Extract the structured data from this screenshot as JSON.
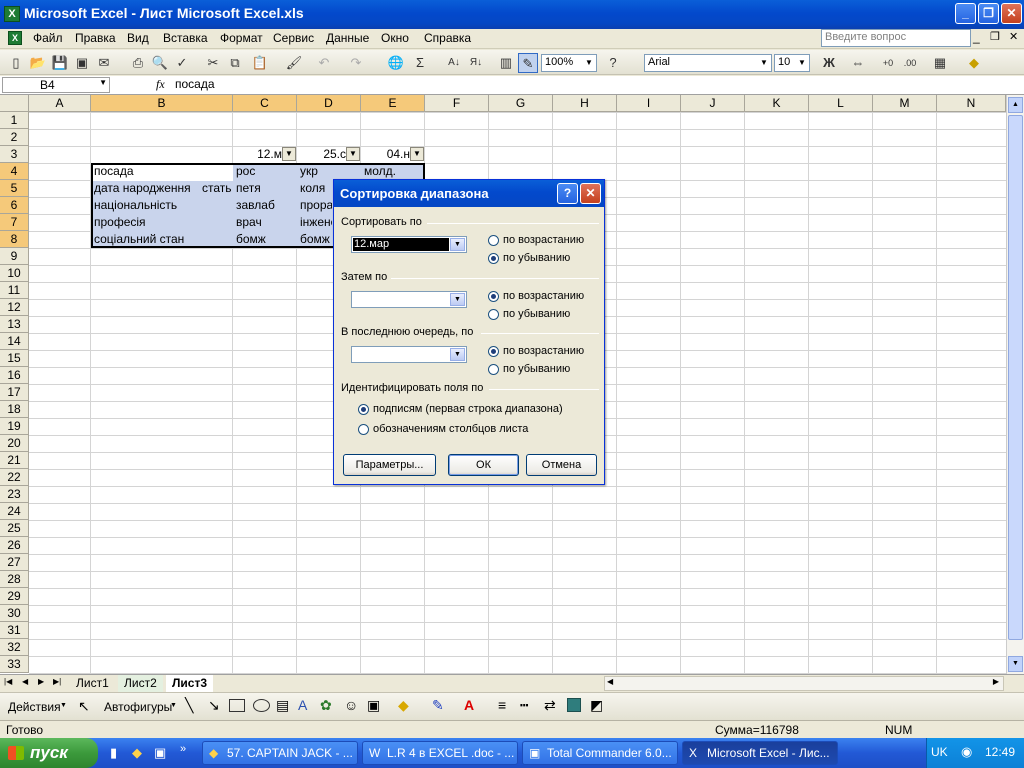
{
  "window": {
    "title": "Microsoft Excel - Лист Microsoft Excel.xls"
  },
  "menu": [
    "Файл",
    "Правка",
    "Вид",
    "Вставка",
    "Формат",
    "Сервис",
    "Данные",
    "Окно",
    "Справка"
  ],
  "ask_placeholder": "Введите вопрос",
  "toolbar": {
    "zoom": "100%",
    "font": "Arial",
    "size": "10",
    "bold": "Ж"
  },
  "formula": {
    "namebox": "B4",
    "fx": "fx",
    "value": "посада"
  },
  "columns": [
    "A",
    "B",
    "C",
    "D",
    "E",
    "F",
    "G",
    "H",
    "I",
    "J",
    "K",
    "L",
    "M",
    "N"
  ],
  "rows": [
    "1",
    "2",
    "3",
    "4",
    "5",
    "6",
    "7",
    "8",
    "9",
    "10",
    "11",
    "12",
    "13",
    "14",
    "15",
    "16",
    "17",
    "18",
    "19",
    "20",
    "21",
    "22",
    "23",
    "24",
    "25",
    "26",
    "27",
    "28",
    "29",
    "30",
    "31",
    "32",
    "33"
  ],
  "cells": {
    "c3": "12.м",
    "d3": "25.с",
    "e3": "04.н",
    "b4": "посада",
    "c4": "рос",
    "d4": "укр",
    "e4": "молд.",
    "b5": "дата народження",
    "b5b": "стать",
    "c5": "петя",
    "d5": "коля",
    "b6": "національність",
    "c6": "завлаб",
    "d6": "прораб",
    "b7": "професія",
    "c7": "врач",
    "d7": "інженер",
    "b8": "соціальний стан",
    "c8": "бомж",
    "d8": "бомж"
  },
  "sheets": [
    "Лист1",
    "Лист2",
    "Лист3"
  ],
  "drawbar": {
    "actions": "Действия",
    "autoshapes": "Автофигуры"
  },
  "status": {
    "ready": "Готово",
    "sum": "Сумма=116798",
    "num": "NUM"
  },
  "taskbar": {
    "start": "пуск",
    "tasks": [
      "57. CAPTAIN JACK - ...",
      "L.R 4 в EXCEL .doc - ...",
      "Total Commander 6.0...",
      "Microsoft Excel - Лис..."
    ],
    "lang": "UK",
    "clock": "12:49"
  },
  "dialog": {
    "title": "Сортировка диапазона",
    "sort_by": "Сортировать по",
    "sort_by_value": "12.мар",
    "then_by": "Затем по",
    "last_by": "В последнюю очередь, по",
    "asc": "по возрастанию",
    "desc": "по убыванию",
    "identify": "Идентифицировать поля по",
    "by_labels": "подписям (первая строка диапазона)",
    "by_columns": "обозначениям столбцов листа",
    "params_btn": "Параметры...",
    "ok_btn": "ОК",
    "cancel_btn": "Отмена"
  },
  "colors": {
    "accent": "#0a5fd8",
    "selection": "#c9d4ec",
    "header_sel": "#f5c97a"
  }
}
